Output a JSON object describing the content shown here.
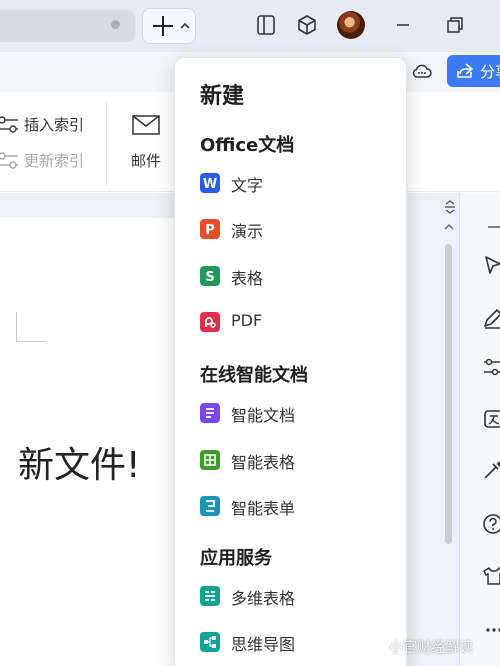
{
  "titlebar": {
    "new_tab_symbol": "+",
    "caret_icon": "chevron-up-icon",
    "icons": [
      "phone-screen-icon",
      "cube-icon",
      "avatar",
      "minimize-icon",
      "restore-icon"
    ]
  },
  "toolbar": {
    "share_label": "分享",
    "cloud_icon": "cloud-chat-icon"
  },
  "ribbon": {
    "insert_index_label": "插入索引",
    "update_index_label": "更新索引",
    "mail_label": "邮件"
  },
  "document": {
    "body_text": "新文件!"
  },
  "menu": {
    "title": "新建",
    "sections": [
      {
        "title": "Office文档",
        "items": [
          {
            "label": "文字",
            "icon": "word-icon",
            "color": "#2b5ce6"
          },
          {
            "label": "演示",
            "icon": "presentation-icon",
            "color": "#e0502c"
          },
          {
            "label": "表格",
            "icon": "spreadsheet-icon",
            "color": "#1f9a5a"
          },
          {
            "label": "PDF",
            "icon": "pdf-icon",
            "color": "#e0314b"
          }
        ]
      },
      {
        "title": "在线智能文档",
        "items": [
          {
            "label": "智能文档",
            "icon": "smart-doc-icon",
            "color": "#7b4ae6"
          },
          {
            "label": "智能表格",
            "icon": "smart-sheet-icon",
            "color": "#3f9a2c"
          },
          {
            "label": "智能表单",
            "icon": "smart-form-icon",
            "color": "#1b93b5"
          }
        ]
      },
      {
        "title": "应用服务",
        "items": [
          {
            "label": "多维表格",
            "icon": "multi-dim-table-icon",
            "color": "#12a38f"
          },
          {
            "label": "思维导图",
            "icon": "mind-map-icon",
            "color": "#14a099"
          }
        ]
      }
    ]
  },
  "watermark": {
    "text": "小官财经解读"
  },
  "colors": {
    "accent": "#3d7bf5",
    "titlebar_bg": "#e6ebf2",
    "doc_bg": "#eef1f5"
  }
}
